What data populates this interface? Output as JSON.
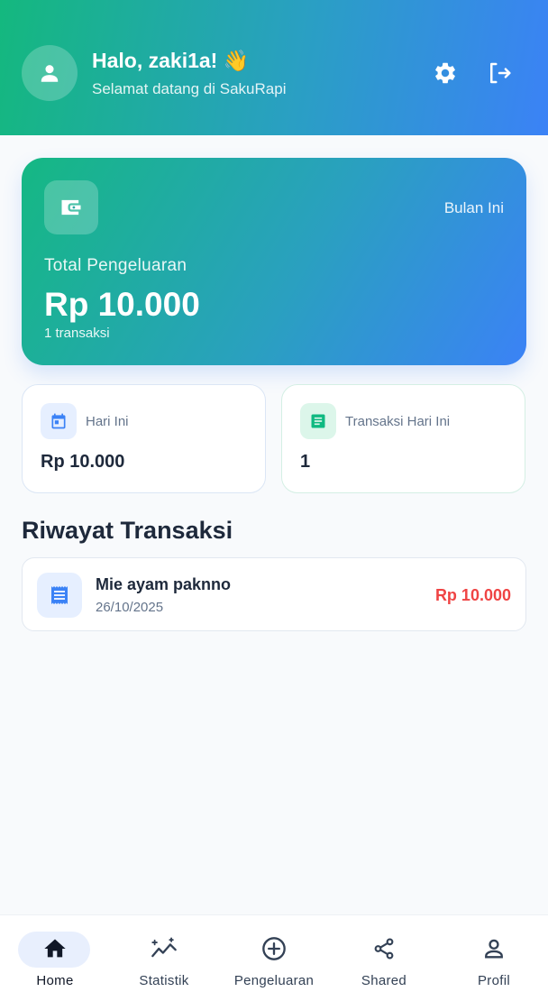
{
  "header": {
    "greeting": "Halo, zaki1a! 👋",
    "subtitle": "Selamat datang di SakuRapi"
  },
  "summary": {
    "period_label": "Bulan Ini",
    "title": "Total Pengeluaran",
    "amount": "Rp 10.000",
    "count_text": "1 transaksi"
  },
  "stats": [
    {
      "label": "Hari Ini",
      "value": "Rp 10.000",
      "icon": "calendar-icon"
    },
    {
      "label": "Transaksi Hari Ini",
      "value": "1",
      "icon": "list-icon"
    }
  ],
  "history": {
    "title": "Riwayat Transaksi",
    "items": [
      {
        "name": "Mie ayam paknno",
        "date": "26/10/2025",
        "amount": "Rp 10.000",
        "icon": "receipt-icon"
      }
    ]
  },
  "nav": {
    "items": [
      {
        "label": "Home",
        "icon": "home-icon",
        "active": true
      },
      {
        "label": "Statistik",
        "icon": "statistics-icon",
        "active": false
      },
      {
        "label": "Pengeluaran",
        "icon": "add-circle-icon",
        "active": false
      },
      {
        "label": "Shared",
        "icon": "share-icon",
        "active": false
      },
      {
        "label": "Profil",
        "icon": "person-icon",
        "active": false
      }
    ]
  },
  "colors": {
    "accent_green": "#14b87e",
    "accent_blue": "#3b82f6",
    "expense_red": "#ef4444"
  }
}
